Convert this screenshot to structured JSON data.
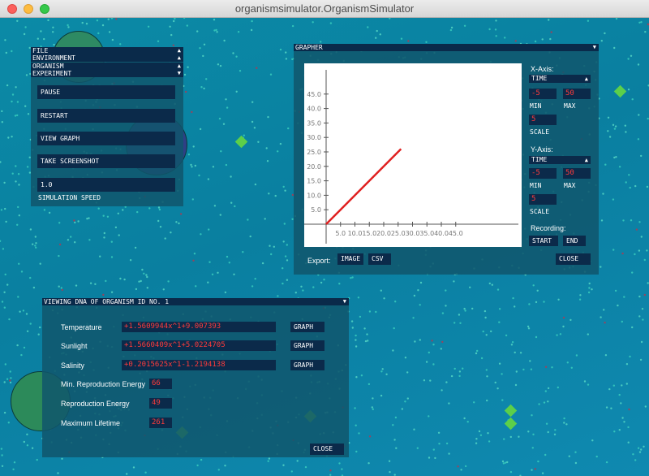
{
  "window": {
    "title": "organismsimulator.OrganismSimulator"
  },
  "control_panel": {
    "menus": [
      "FILE",
      "ENVIRONMENT",
      "ORGANISM",
      "EXPERIMENT"
    ],
    "buttons": {
      "pause": "PAUSE",
      "restart": "RESTART",
      "view_graph": "VIEW GRAPH",
      "take_screenshot": "TAKE SCREENSHOT"
    },
    "speed_value": "1.0",
    "speed_label": "SIMULATION SPEED"
  },
  "grapher": {
    "title": "GRAPHER",
    "x_axis": {
      "label": "X-Axis:",
      "variable": "TIME",
      "min": "-5",
      "max": "50",
      "min_label": "MIN",
      "max_label": "MAX",
      "scale": "5",
      "scale_label": "SCALE"
    },
    "y_axis": {
      "label": "Y-Axis:",
      "variable": "TIME",
      "min": "-5",
      "max": "50",
      "min_label": "MIN",
      "max_label": "MAX",
      "scale": "5",
      "scale_label": "SCALE"
    },
    "recording_label": "Recording:",
    "start": "START",
    "end": "END",
    "close": "CLOSE",
    "export_label": "Export:",
    "export_image": "IMAGE",
    "export_csv": "CSV"
  },
  "chart_data": {
    "type": "line",
    "x_ticks": [
      "5.0",
      "10.0",
      "15.0",
      "20.0",
      "25.0",
      "30.0",
      "35.0",
      "40.0",
      "45.0"
    ],
    "y_ticks": [
      "5.0",
      "10.0",
      "15.0",
      "20.0",
      "25.0",
      "30.0",
      "35.0",
      "40.0",
      "45.0"
    ],
    "xlim": [
      -5,
      50
    ],
    "ylim": [
      -5,
      50
    ],
    "series": [
      {
        "x": [
          0,
          26
        ],
        "y": [
          0,
          26
        ],
        "color": "#e02020"
      }
    ]
  },
  "dna_panel": {
    "title": "VIEWING DNA OF ORGANISM ID NO. 1",
    "rows": [
      {
        "label": "Temperature",
        "value": "+1.5609944x^1+9.007393",
        "button": "GRAPH"
      },
      {
        "label": "Sunlight",
        "value": "+1.5660409x^1+5.0224705",
        "button": "GRAPH"
      },
      {
        "label": "Salinity",
        "value": "+0.2015625x^1-1.2194138",
        "button": "GRAPH"
      }
    ],
    "min_repro_label": "Min. Reproduction Energy",
    "min_repro_value": "66",
    "repro_label": "Reproduction Energy",
    "repro_value": "49",
    "max_life_label": "Maximum Lifetime",
    "max_life_value": "261",
    "close": "CLOSE"
  }
}
